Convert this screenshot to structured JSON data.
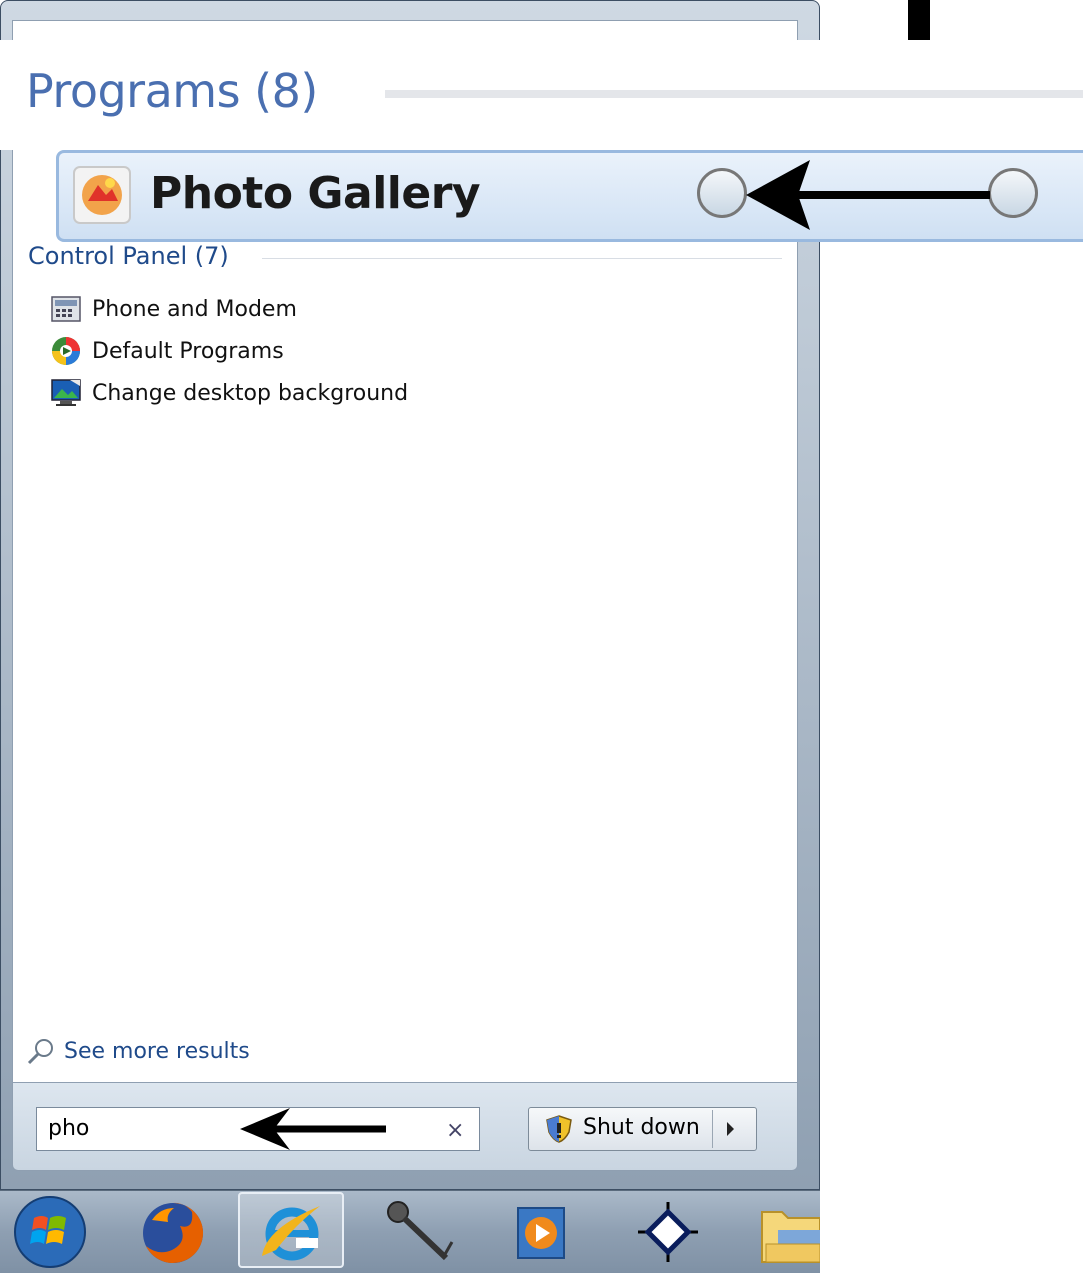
{
  "programs_header": "Programs (8)",
  "highlighted_program": "Photo Gallery",
  "control_panel": {
    "header": "Control Panel (7)",
    "items": [
      {
        "label": "Phone and Modem",
        "icon": "phone-modem-icon"
      },
      {
        "label": "Default Programs",
        "icon": "default-programs-icon"
      },
      {
        "label": "Change desktop background",
        "icon": "desktop-background-icon"
      }
    ]
  },
  "see_more": "See more results",
  "search": {
    "value": "pho",
    "clear": "×"
  },
  "shutdown": {
    "label": "Shut down"
  },
  "taskbar": {
    "items": [
      "start-orb-icon",
      "firefox-icon",
      "internet-explorer-icon",
      "microphone-icon",
      "media-player-icon",
      "target-icon",
      "folder-icon"
    ]
  },
  "colors": {
    "accent": "#1f4a8a",
    "programs_header": "#4a6fb0",
    "highlight": "#cfe0f3"
  }
}
